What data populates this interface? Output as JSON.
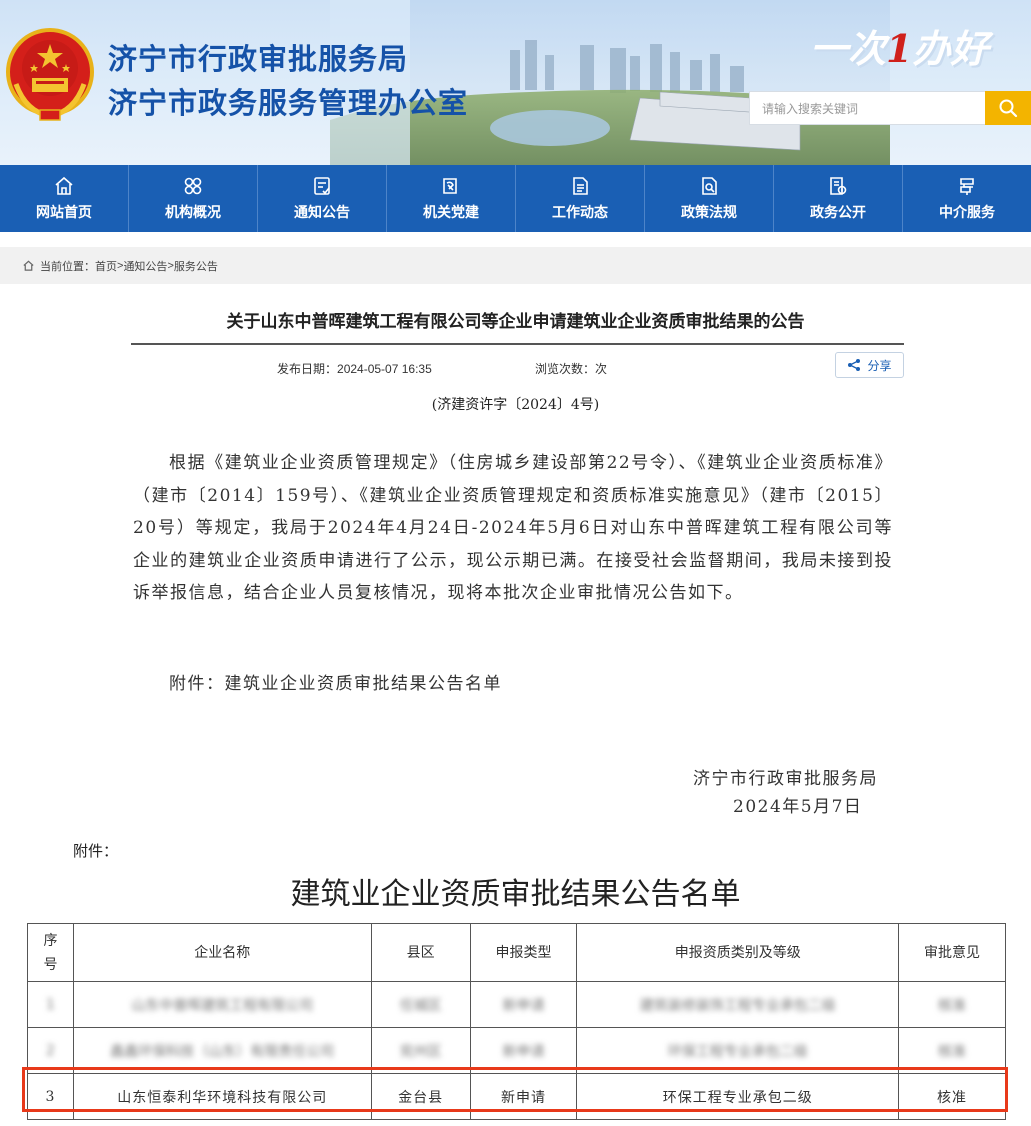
{
  "header": {
    "line1": "济宁市行政审批服务局",
    "line2": "济宁市政务服务管理办公室",
    "slogan_pre": "一次",
    "slogan_num": "1",
    "slogan_post": "办好",
    "search": {
      "placeholder": "请输入搜索关键词",
      "icon": "search-icon"
    },
    "colors": {
      "brand_blue": "#1552a8",
      "search_button": "#f3b400"
    }
  },
  "nav": {
    "background": "#1a5fb4",
    "items": [
      {
        "label": "网站首页",
        "icon": "home-icon"
      },
      {
        "label": "机构概况",
        "icon": "org-icon"
      },
      {
        "label": "通知公告",
        "icon": "notice-icon"
      },
      {
        "label": "机关党建",
        "icon": "party-icon"
      },
      {
        "label": "工作动态",
        "icon": "document-icon"
      },
      {
        "label": "政策法规",
        "icon": "policy-icon"
      },
      {
        "label": "政务公开",
        "icon": "gov-open-icon"
      },
      {
        "label": "中介服务",
        "icon": "service-icon"
      }
    ]
  },
  "breadcrumb": {
    "prefix": "当前位置：",
    "items": [
      "首页",
      "通知公告",
      "服务公告"
    ],
    "separator": ">"
  },
  "article": {
    "title": "关于山东中普晖建筑工程有限公司等企业申请建筑业企业资质审批结果的公告",
    "publish_label": "发布日期：",
    "publish_date": "2024-05-07 16:35",
    "views_label": "浏览次数：",
    "views_value": "次",
    "share_label": "分享",
    "doc_number": "(济建资许字〔2024〕4号)",
    "body": "根据《建筑业企业资质管理规定》（住房城乡建设部第22号令）、《建筑业企业资质标准》（建市〔2014〕159号）、《建筑业企业资质管理规定和资质标准实施意见》（建市〔2015〕20号）等规定，我局于2024年4月24日-2024年5月6日对山东中普晖建筑工程有限公司等企业的建筑业企业资质申请进行了公示，现公示期已满。在接受社会监督期间，我局未接到投诉举报信息，结合企业人员复核情况，现将本批次企业审批情况公告如下。",
    "attachment": "附件：建筑业企业资质审批结果公告名单",
    "signature_org": "济宁市行政审批服务局",
    "signature_date": "2024年5月7日"
  },
  "annex": {
    "label": "附件：",
    "title": "建筑业企业资质审批结果公告名单",
    "columns": [
      "序号",
      "企业名称",
      "县区",
      "申报类型",
      "申报资质类别及等级",
      "审批意见"
    ],
    "rows": [
      [
        "1",
        "山东中普晖建筑工程有限公司",
        "任城区",
        "新申请",
        "建筑装修装饰工程专业承包二级",
        "核准"
      ],
      [
        "2",
        "鑫鑫环保科技（山东）有限责任公司",
        "兖州区",
        "新申请",
        "环保工程专业承包二级",
        "核准"
      ],
      [
        "3",
        "山东恒泰利华环境科技有限公司",
        "金台县",
        "新申请",
        "环保工程专业承包二级",
        "核准"
      ]
    ],
    "highlight_color": "#e8391a"
  }
}
